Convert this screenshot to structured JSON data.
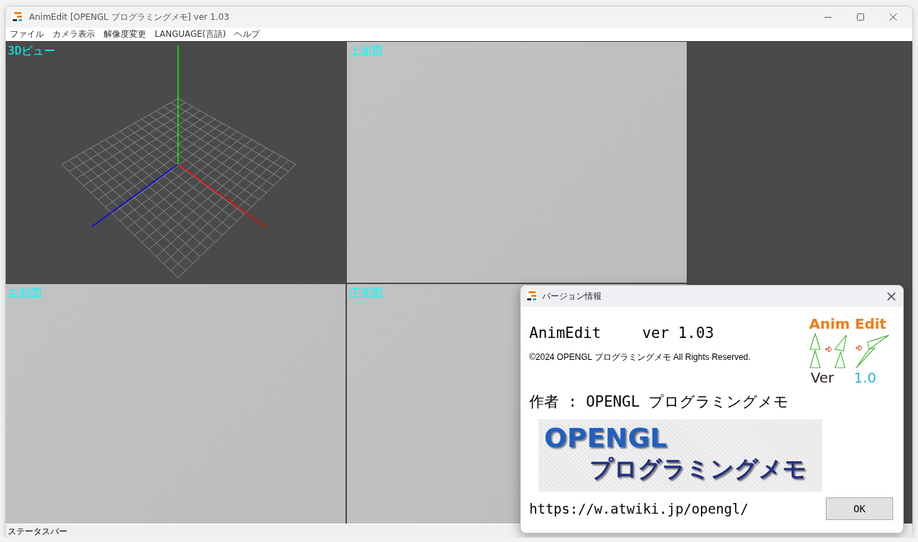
{
  "window": {
    "title": "AnimEdit [OPENGL プログラミングメモ] ver 1.03"
  },
  "menu": [
    "ファイル",
    "カメラ表示",
    "解像度変更",
    "LANGUAGE(言語)",
    "ヘルプ"
  ],
  "viewports": [
    {
      "label": "3Dビュー",
      "kind": "perspective"
    },
    {
      "label": "上面図",
      "kind": "ortho"
    },
    {
      "label": "左面図",
      "kind": "ortho"
    },
    {
      "label": "正面図",
      "kind": "ortho"
    }
  ],
  "status_bar": "ステータスバー",
  "dialog": {
    "title": "バージョン情報",
    "app_name": "AnimEdit",
    "version": "ver 1.03",
    "copyright": "©2024 OPENGL プログラミングメモ All Rights Reserved.",
    "logo_title": "Anim Edit",
    "logo_ver": "Ver",
    "logo_number": "1.0",
    "author": "作者 : OPENGL プログラミングメモ",
    "banner_line_1": "OPENGL",
    "banner_line_2": "プログラミングメモ",
    "url": "https://w.atwiki.jp/opengl/",
    "ok_button": "OK"
  }
}
